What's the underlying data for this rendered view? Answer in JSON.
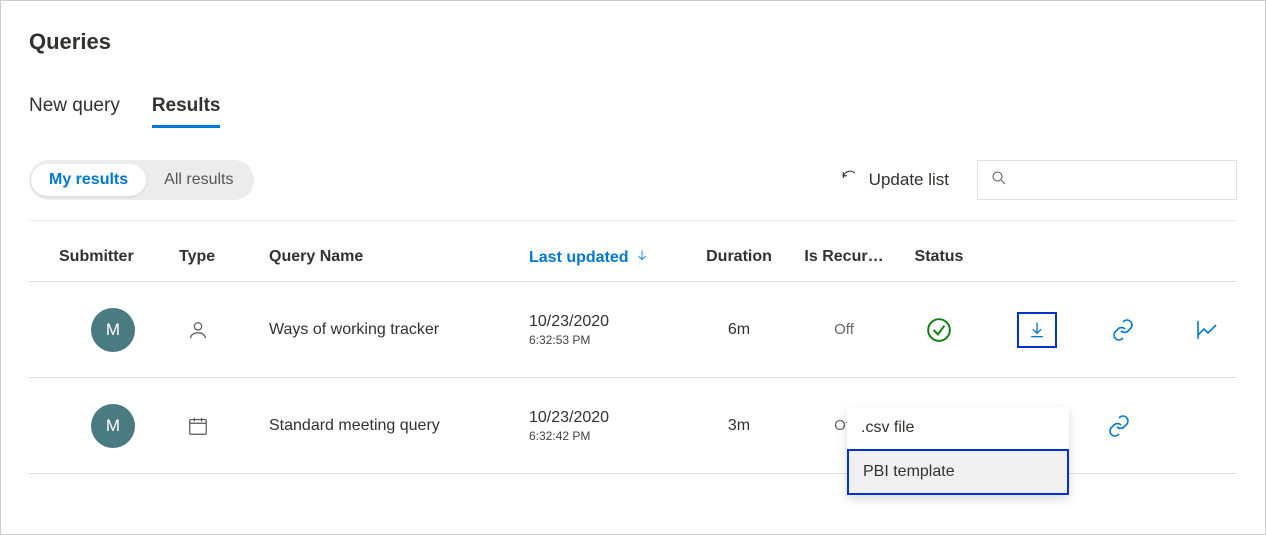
{
  "page": {
    "title": "Queries"
  },
  "tabs": {
    "new_query": "New query",
    "results": "Results"
  },
  "segmented": {
    "my": "My results",
    "all": "All results"
  },
  "toolbar": {
    "update": "Update list"
  },
  "columns": {
    "submitter": "Submitter",
    "type": "Type",
    "name": "Query Name",
    "updated": "Last updated",
    "duration": "Duration",
    "recur": "Is Recur…",
    "status": "Status"
  },
  "rows": [
    {
      "avatar": "M",
      "type": "person",
      "name": "Ways of working tracker",
      "date": "10/23/2020",
      "time": "6:32:53 PM",
      "duration": "6m",
      "recur": "Off"
    },
    {
      "avatar": "M",
      "type": "calendar",
      "name": "Standard meeting query",
      "date": "10/23/2020",
      "time": "6:32:42 PM",
      "duration": "3m",
      "recur": "Off"
    }
  ],
  "dropdown": {
    "csv": ".csv file",
    "pbi": "PBI template"
  }
}
